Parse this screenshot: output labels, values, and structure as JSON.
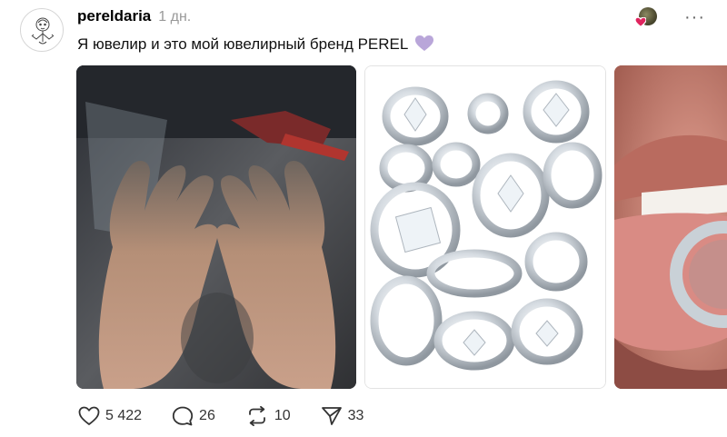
{
  "post": {
    "username": "pereldaria",
    "time": "1 дн.",
    "caption": "Я ювелир и это мой ювелирный бренд PEREL",
    "caption_emoji": "purple-heart-icon"
  },
  "header_tools": {
    "avatar_icon": "liked-avatar-icon",
    "more_icon": "more-icon",
    "more_label": "···"
  },
  "media": [
    {
      "name": "photo-hands",
      "description_icon": "photo"
    },
    {
      "name": "photo-rings-collage",
      "description_icon": "photo"
    },
    {
      "name": "photo-mouth-ring",
      "description_icon": "photo"
    }
  ],
  "actions": {
    "likes": "5 422",
    "comments": "26",
    "reposts": "10",
    "shares": "33"
  },
  "colors": {
    "accent_heart": "#e0245e",
    "purple_heart": "#b9a6d9",
    "muted": "#999999"
  }
}
